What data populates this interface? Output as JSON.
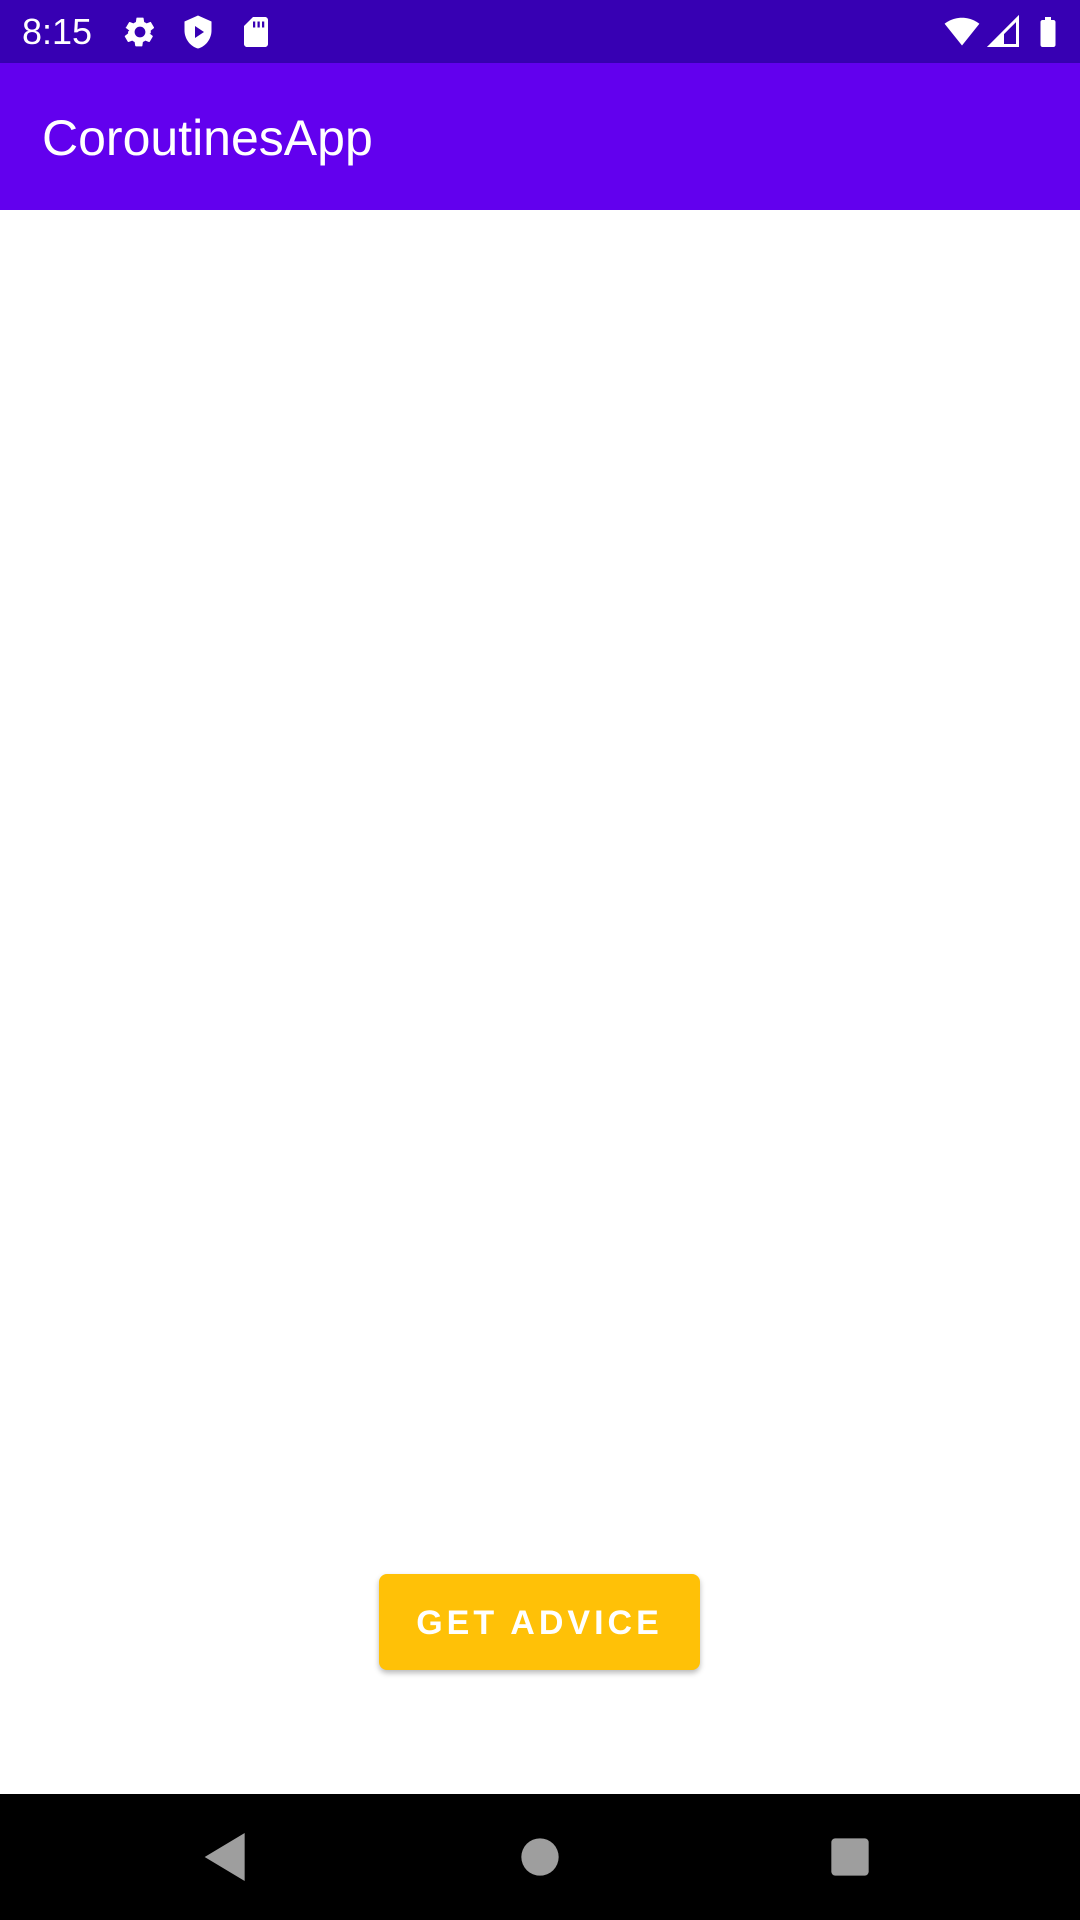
{
  "status_bar": {
    "time": "8:15",
    "background_color": "#3700b3",
    "icons_left": [
      "gear-icon",
      "play-protect-icon",
      "sd-card-icon"
    ],
    "icons_right": [
      "wifi-icon",
      "cell-signal-icon",
      "battery-icon"
    ]
  },
  "app_bar": {
    "title": "CoroutinesApp",
    "background_color": "#6200ee"
  },
  "main": {
    "advice_button_label": "GET ADVICE",
    "button_color": "#ffc107"
  },
  "nav_bar": {
    "buttons": [
      "back-icon",
      "home-icon",
      "recents-icon"
    ]
  }
}
